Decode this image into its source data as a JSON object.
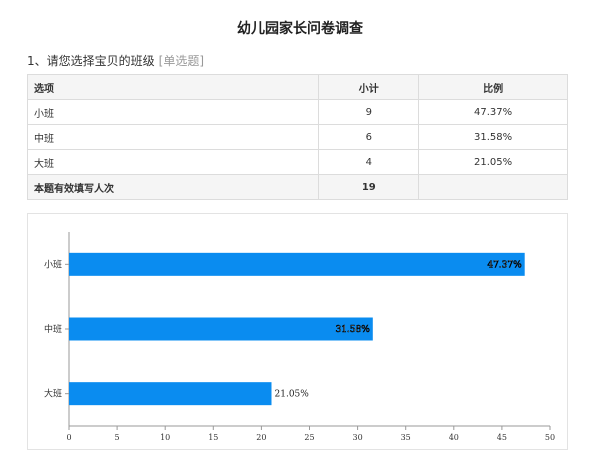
{
  "page": {
    "title": "幼儿园家长问卷调查"
  },
  "question": {
    "text": "1、请您选择宝贝的班级",
    "type": "[单选题]"
  },
  "table": {
    "headers": [
      "选项",
      "小计",
      "比例"
    ],
    "rows": [
      {
        "option": "小班",
        "count": "9",
        "ratio": "47.37%"
      },
      {
        "option": "中班",
        "count": "6",
        "ratio": "31.58%"
      },
      {
        "option": "大班",
        "count": "4",
        "ratio": "21.05%"
      }
    ],
    "total": {
      "label": "本题有效填写人次",
      "count": "19",
      "ratio": ""
    }
  },
  "chart_data": {
    "type": "bar",
    "orientation": "horizontal",
    "categories": [
      "小班",
      "中班",
      "大班"
    ],
    "values": [
      47.37,
      31.58,
      21.05
    ],
    "data_labels": [
      "47.37%",
      "31.58%",
      "21.05%"
    ],
    "xlim": [
      0,
      50
    ],
    "xticks": [
      0,
      5,
      10,
      15,
      20,
      25,
      30,
      35,
      40,
      45,
      50
    ],
    "bar_color": "#0a8cf0",
    "grid": false,
    "legend": "none"
  }
}
